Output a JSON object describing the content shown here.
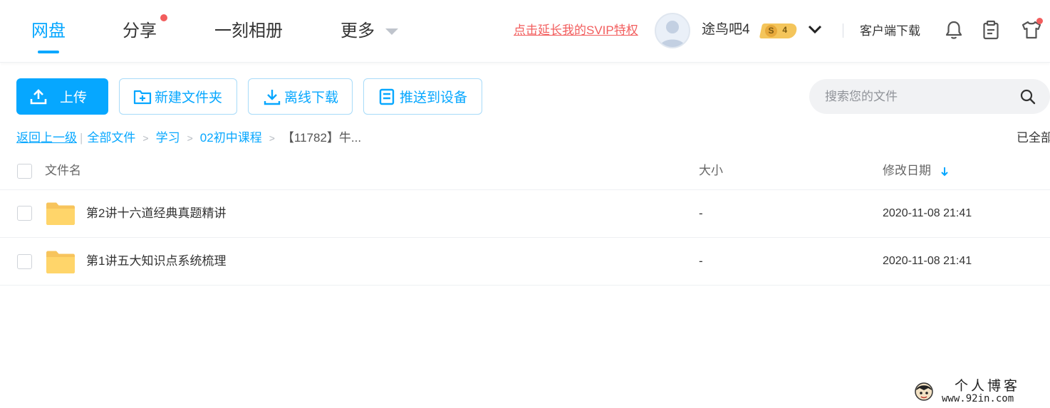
{
  "nav": {
    "tabs": [
      {
        "label": "网盘",
        "active": true
      },
      {
        "label": "分享",
        "has_dot": true
      },
      {
        "label": "一刻相册"
      },
      {
        "label": "更多"
      }
    ],
    "svip_link": "点击延长我的SVIP特权",
    "username": "途鸟吧4",
    "vip_badge": {
      "letter": "S",
      "level": "4"
    },
    "client_download": "客户端下载",
    "icons": [
      "bell-icon",
      "clipboard-icon",
      "tshirt-icon"
    ],
    "accent_color": "#06a7ff",
    "dot_color": "#f25d5d"
  },
  "toolbar": {
    "upload": "上传",
    "new_folder": "新建文件夹",
    "offline_download": "离线下载",
    "push_to_device": "推送到设备"
  },
  "search": {
    "placeholder": "搜索您的文件",
    "value": ""
  },
  "breadcrumb": {
    "back": "返回上一级",
    "items": [
      "全部文件",
      "学习",
      "02初中课程"
    ],
    "current": "【11782】牛...",
    "status": "已全部"
  },
  "table": {
    "columns": {
      "name": "文件名",
      "size": "大小",
      "date": "修改日期"
    },
    "sort": "date-desc",
    "rows": [
      {
        "name": "第2讲十六道经典真题精讲",
        "size": "-",
        "date": "2020-11-08 21:41",
        "type": "folder"
      },
      {
        "name": "第1讲五大知识点系统梳理",
        "size": "-",
        "date": "2020-11-08 21:41",
        "type": "folder"
      }
    ]
  },
  "watermark": {
    "title": "个人博客",
    "url": "www.92in.com"
  }
}
